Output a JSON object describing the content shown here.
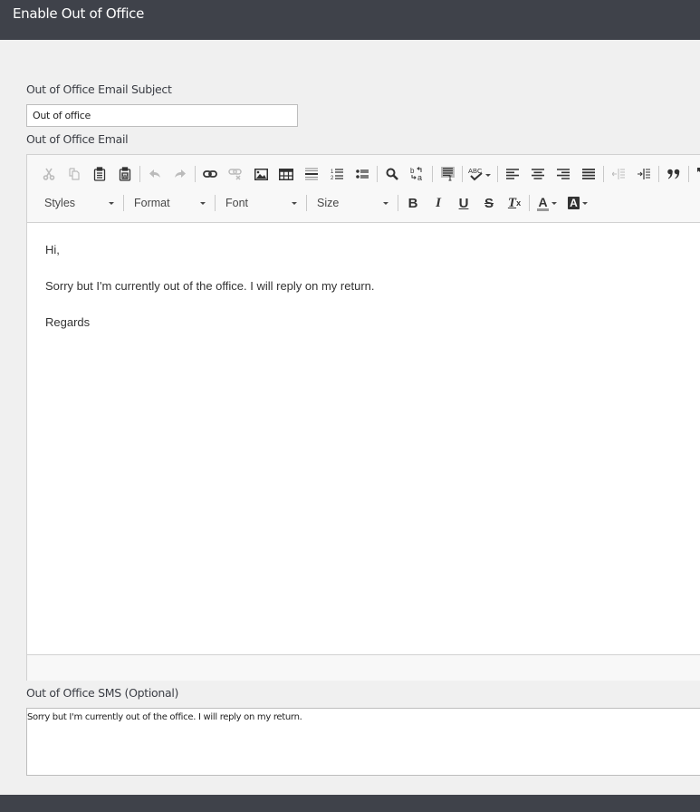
{
  "header": {
    "title": "Enable Out of Office"
  },
  "subject": {
    "label": "Out of Office Email Subject",
    "value": "Out of office"
  },
  "email": {
    "label": "Out of Office Email",
    "toolbar": {
      "row1": [
        {
          "name": "cut",
          "icon": "scissors-icon",
          "enabled": false
        },
        {
          "name": "copy",
          "icon": "copy-icon",
          "enabled": false
        },
        {
          "name": "paste",
          "icon": "clipboard-icon",
          "enabled": true
        },
        {
          "name": "paste-from-word",
          "icon": "clipboard-word-icon",
          "enabled": true
        },
        {
          "name": "undo",
          "icon": "undo-icon",
          "enabled": false
        },
        {
          "name": "redo",
          "icon": "redo-icon",
          "enabled": false
        },
        {
          "name": "link",
          "icon": "link-icon",
          "enabled": true
        },
        {
          "name": "unlink",
          "icon": "unlink-icon",
          "enabled": false
        },
        {
          "name": "image",
          "icon": "image-icon",
          "enabled": true
        },
        {
          "name": "table",
          "icon": "table-icon",
          "enabled": true
        },
        {
          "name": "horizontal-line",
          "icon": "horizontal-line-icon",
          "enabled": true
        },
        {
          "name": "numbered-list",
          "icon": "numbered-list-icon",
          "enabled": true
        },
        {
          "name": "bulleted-list",
          "icon": "bulleted-list-icon",
          "enabled": true
        },
        {
          "name": "find",
          "icon": "search-icon",
          "enabled": true
        },
        {
          "name": "replace",
          "icon": "replace-icon",
          "enabled": true
        },
        {
          "name": "select-all",
          "icon": "select-all-icon",
          "enabled": true
        },
        {
          "name": "spell-check",
          "icon": "spell-check-icon",
          "enabled": true
        },
        {
          "name": "align-left",
          "icon": "align-left-icon",
          "enabled": true
        },
        {
          "name": "align-center",
          "icon": "align-center-icon",
          "enabled": true
        },
        {
          "name": "align-right",
          "icon": "align-right-icon",
          "enabled": true
        },
        {
          "name": "justify",
          "icon": "justify-icon",
          "enabled": true
        },
        {
          "name": "decrease-indent",
          "icon": "outdent-icon",
          "enabled": false
        },
        {
          "name": "increase-indent",
          "icon": "indent-icon",
          "enabled": true
        },
        {
          "name": "blockquote",
          "icon": "quote-icon",
          "enabled": true
        },
        {
          "name": "maximize",
          "icon": "maximize-icon",
          "enabled": true
        }
      ],
      "combos": {
        "styles": "Styles",
        "format": "Format",
        "font": "Font",
        "size": "Size"
      },
      "format_buttons": {
        "bold": "B",
        "italic": "I",
        "underline": "U",
        "strike": "S",
        "remove_format": "T",
        "remove_format_sub": "x",
        "text_color": "A",
        "bg_color": "A"
      }
    },
    "body": {
      "line1": "Hi,",
      "line2": "Sorry but I'm currently out of the office. I will reply on my return.",
      "line3": "Regards"
    }
  },
  "sms": {
    "label": "Out of Office SMS (Optional)",
    "value": "Sorry but I'm currently out of the office. I will reply on my return."
  },
  "colors": {
    "header_bg": "#3f424a",
    "page_bg": "#f0f0f0",
    "toolbar_bg": "#f8f8f8",
    "border": "#d1d1d1"
  }
}
